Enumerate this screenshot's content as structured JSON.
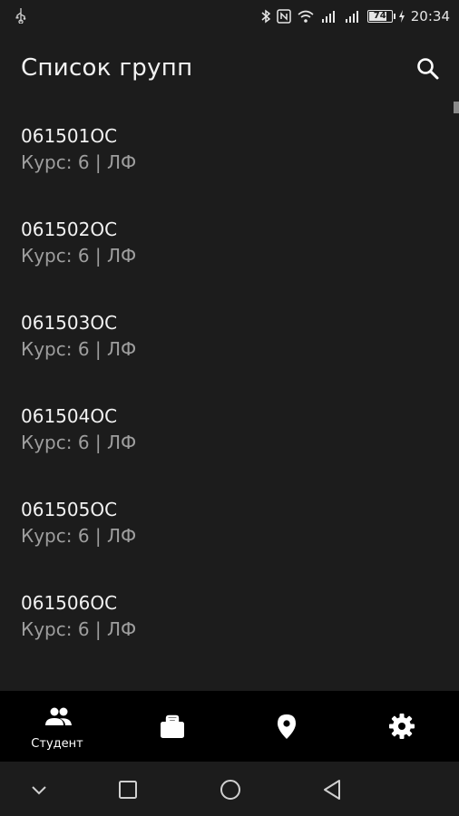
{
  "status_bar": {
    "time": "20:34",
    "battery": "74",
    "icons": [
      "usb-icon",
      "bluetooth-icon",
      "nfc-icon",
      "wifi-icon",
      "signal-icon",
      "signal-icon",
      "battery-icon",
      "charging-icon"
    ]
  },
  "app_bar": {
    "title": "Список групп",
    "search_icon": "search-icon"
  },
  "groups": [
    {
      "name": "061501ОС",
      "info": "Курс: 6 | ЛФ"
    },
    {
      "name": "061502ОС",
      "info": "Курс: 6 | ЛФ"
    },
    {
      "name": "061503ОС",
      "info": "Курс: 6 | ЛФ"
    },
    {
      "name": "061504ОС",
      "info": "Курс: 6 | ЛФ"
    },
    {
      "name": "061505ОС",
      "info": "Курс: 6 | ЛФ"
    },
    {
      "name": "061506ОС",
      "info": "Курс: 6 | ЛФ"
    }
  ],
  "bottom_nav": {
    "items": [
      {
        "icon": "people-icon",
        "label": "Студент",
        "active": true
      },
      {
        "icon": "briefcase-icon",
        "label": ""
      },
      {
        "icon": "location-pin-icon",
        "label": ""
      },
      {
        "icon": "gear-icon",
        "label": ""
      }
    ]
  },
  "system_nav": [
    "chevron-down-icon",
    "recents-icon",
    "home-icon",
    "back-icon"
  ],
  "colors": {
    "background": "#1c1c1c",
    "nav_background": "#000000",
    "primary_text": "#f2f2f2",
    "secondary_text": "#9e9e9e"
  }
}
